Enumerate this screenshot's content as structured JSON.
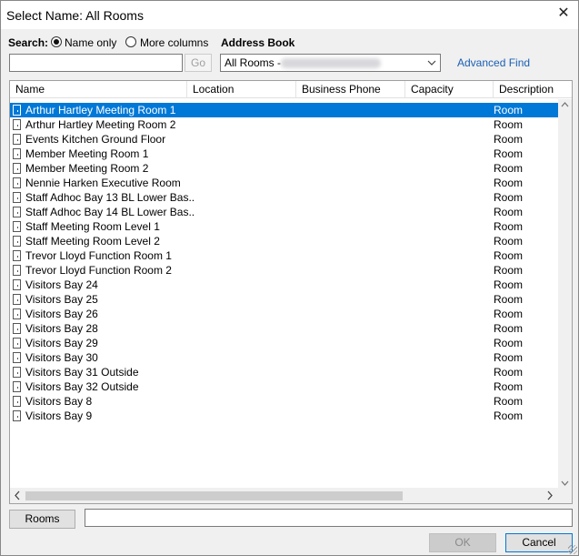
{
  "window": {
    "title": "Select Name: All Rooms",
    "close_glyph": "✕"
  },
  "search": {
    "label": "Search:",
    "option_name_only": "Name only",
    "option_more_columns": "More columns",
    "selected_option": "name_only",
    "value": "",
    "go_label": "Go"
  },
  "address_book": {
    "label": "Address Book",
    "selected_value": "All Rooms - "
  },
  "advanced_find_label": "Advanced Find",
  "columns": [
    "Name",
    "Location",
    "Business Phone",
    "Capacity",
    "Description"
  ],
  "rows": [
    {
      "name": "Arthur Hartley Meeting Room 1",
      "description": "Room",
      "selected": true
    },
    {
      "name": "Arthur Hartley Meeting Room 2",
      "description": "Room"
    },
    {
      "name": "Events Kitchen Ground Floor",
      "description": "Room"
    },
    {
      "name": "Member Meeting Room 1",
      "description": "Room"
    },
    {
      "name": "Member Meeting Room 2",
      "description": "Room"
    },
    {
      "name": "Nennie Harken Executive Room",
      "description": "Room"
    },
    {
      "name": "Staff Adhoc Bay 13 BL Lower Bas...",
      "description": "Room"
    },
    {
      "name": "Staff Adhoc Bay 14 BL Lower Bas...",
      "description": "Room"
    },
    {
      "name": "Staff Meeting Room Level 1",
      "description": "Room"
    },
    {
      "name": "Staff Meeting Room Level 2",
      "description": "Room"
    },
    {
      "name": "Trevor Lloyd Function Room 1",
      "description": "Room"
    },
    {
      "name": "Trevor Lloyd Function Room 2",
      "description": "Room"
    },
    {
      "name": "Visitors Bay 24",
      "description": "Room"
    },
    {
      "name": "Visitors Bay 25",
      "description": "Room"
    },
    {
      "name": "Visitors Bay 26",
      "description": "Room"
    },
    {
      "name": "Visitors Bay 28",
      "description": "Room"
    },
    {
      "name": "Visitors Bay 29",
      "description": "Room"
    },
    {
      "name": "Visitors Bay 30",
      "description": "Room"
    },
    {
      "name": "Visitors Bay 31 Outside",
      "description": "Room"
    },
    {
      "name": "Visitors Bay 32 Outside",
      "description": "Room"
    },
    {
      "name": "Visitors Bay 8",
      "description": "Room"
    },
    {
      "name": "Visitors Bay 9",
      "description": "Room"
    }
  ],
  "rooms_button_label": "Rooms",
  "rooms_field_value": "",
  "ok_label": "OK",
  "cancel_label": "Cancel",
  "colors": {
    "selection": "#0078d7",
    "link": "#1a5fb4",
    "chrome": "#f0f0f0"
  },
  "icons": [
    "close-icon",
    "radio-icon",
    "chevron-down-icon",
    "room-icon",
    "arrow-up-icon",
    "arrow-down-icon",
    "arrow-left-icon",
    "arrow-right-icon",
    "resize-grip-icon"
  ]
}
